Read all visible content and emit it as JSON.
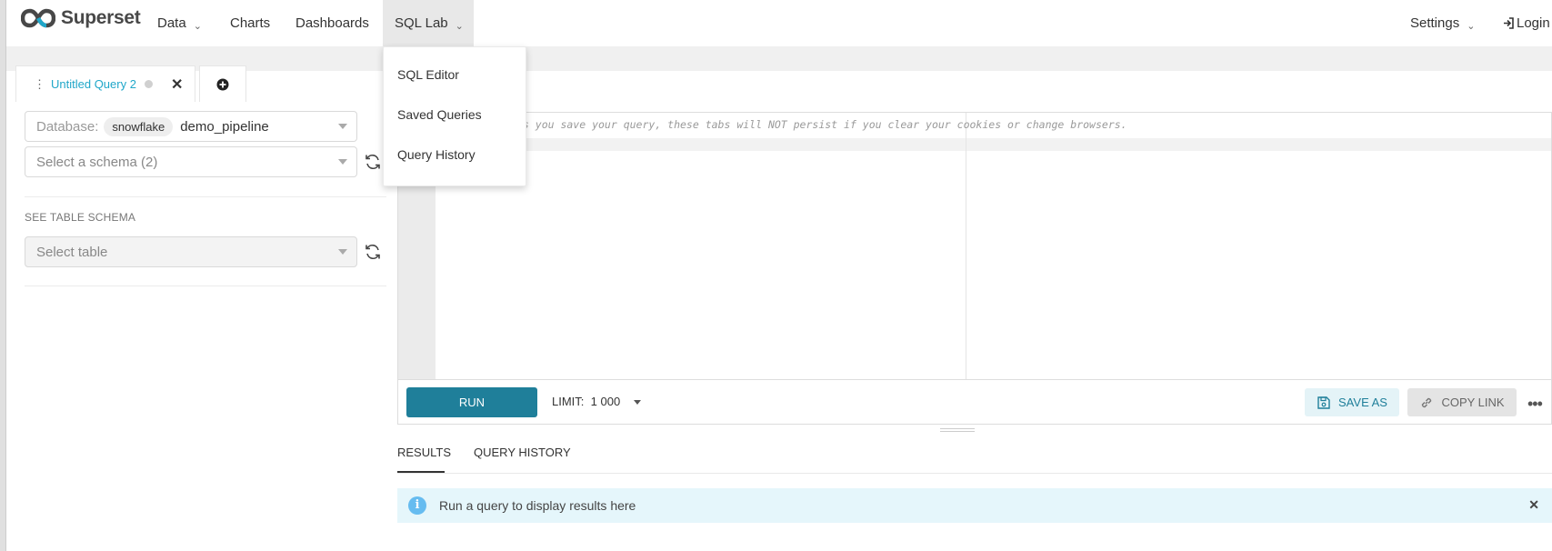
{
  "brand": {
    "name": "Superset"
  },
  "nav": {
    "data": "Data",
    "charts": "Charts",
    "dashboards": "Dashboards",
    "sql_lab": "SQL Lab",
    "settings": "Settings",
    "login": "Login"
  },
  "sql_lab_menu": [
    "SQL Editor",
    "Saved Queries",
    "Query History"
  ],
  "tabs": [
    {
      "label": "Untitled Query 2",
      "active": true
    }
  ],
  "left_panel": {
    "database_label": "Database:",
    "database_type": "snowflake",
    "database_name": "demo_pipeline",
    "schema_placeholder": "Select a schema (2)",
    "see_table_schema": "SEE TABLE SCHEMA",
    "table_placeholder": "Select table"
  },
  "editor": {
    "comment": "ss you save your query, these tabs will NOT persist if you clear your cookies or change browsers."
  },
  "toolbar": {
    "run": "RUN",
    "limit_label": "LIMIT:",
    "limit_value": "1 000",
    "save_as": "SAVE AS",
    "copy_link": "COPY LINK"
  },
  "results": {
    "tabs": [
      "RESULTS",
      "QUERY HISTORY"
    ],
    "info": "Run a query to display results here"
  },
  "colors": {
    "accent": "#20a7c9",
    "run_button": "#1f7f9a",
    "info_bg": "#e5f6fb"
  },
  "icons": [
    "superset-logo-icon",
    "chevron-down-icon",
    "login-icon",
    "drag-grip-icon",
    "close-icon",
    "add-tab-icon",
    "refresh-icon",
    "save-icon",
    "link-icon",
    "more-icon",
    "info-icon"
  ]
}
